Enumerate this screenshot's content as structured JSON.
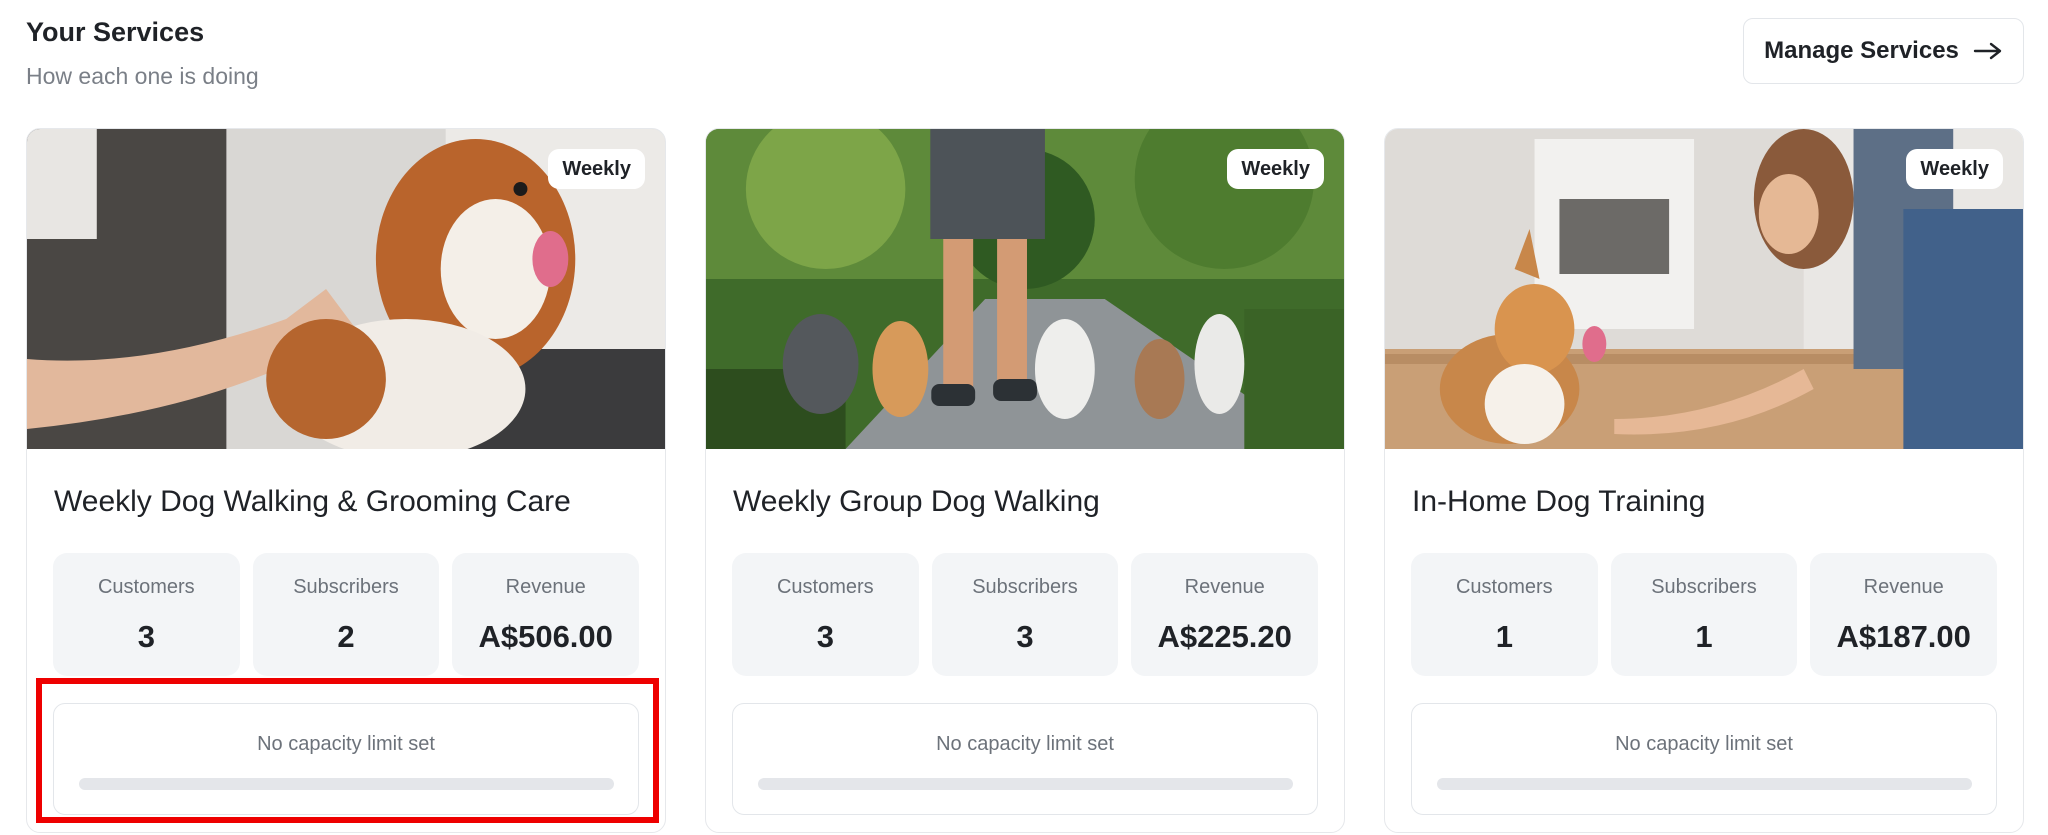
{
  "header": {
    "title": "Your Services",
    "subtitle": "How each one is doing",
    "manage_label": "Manage Services"
  },
  "services": [
    {
      "badge": "Weekly",
      "title": "Weekly Dog Walking & Grooming Care",
      "stats": [
        {
          "label": "Customers",
          "value": "3"
        },
        {
          "label": "Subscribers",
          "value": "2"
        },
        {
          "label": "Revenue",
          "value": "A$506.00"
        }
      ],
      "capacity_label": "No capacity limit set",
      "capacity_fraction": 0
    },
    {
      "badge": "Weekly",
      "title": "Weekly Group Dog Walking",
      "stats": [
        {
          "label": "Customers",
          "value": "3"
        },
        {
          "label": "Subscribers",
          "value": "3"
        },
        {
          "label": "Revenue",
          "value": "A$225.20"
        }
      ],
      "capacity_label": "No capacity limit set",
      "capacity_fraction": 0
    },
    {
      "badge": "Weekly",
      "title": "In-Home Dog Training",
      "stats": [
        {
          "label": "Customers",
          "value": "1"
        },
        {
          "label": "Subscribers",
          "value": "1"
        },
        {
          "label": "Revenue",
          "value": "A$187.00"
        }
      ],
      "capacity_label": "No capacity limit set",
      "capacity_fraction": 0
    }
  ],
  "colors": {
    "highlight": "#ee0000",
    "stat_bg": "#f3f5f7",
    "text": "#1f2227",
    "muted": "#7a7f87"
  }
}
